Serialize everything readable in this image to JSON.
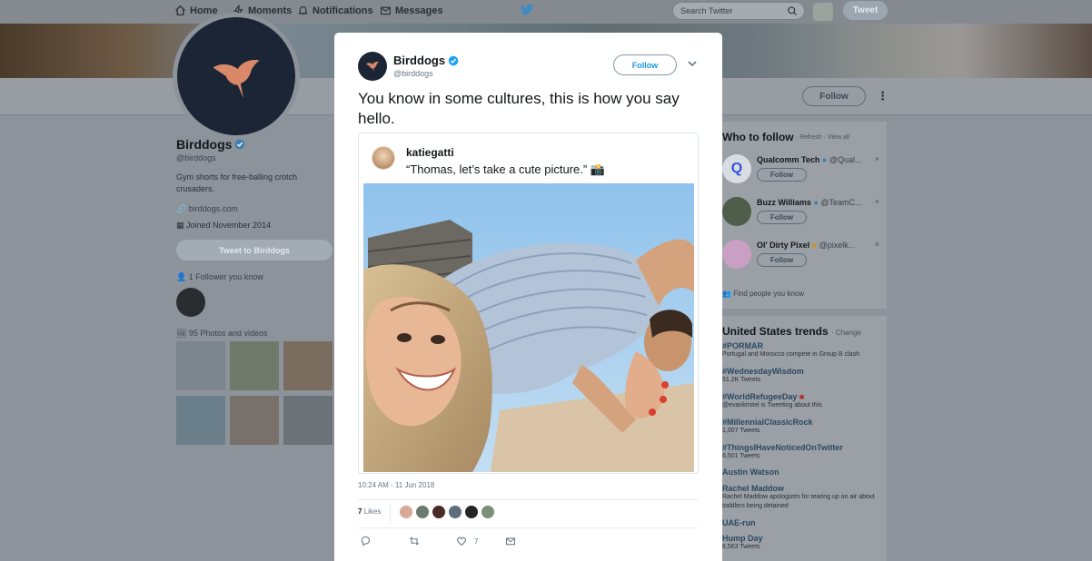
{
  "nav": {
    "home": "Home",
    "moments": "Moments",
    "notifications": "Notifications",
    "messages": "Messages",
    "search_placeholder": "Search Twitter",
    "tweet_button": "Tweet"
  },
  "profile": {
    "name": "Birddogs",
    "handle": "@birddogs",
    "bio": "Gym shorts for free-balling crotch crusaders.",
    "website": "birddogs.com",
    "joined": "Joined November 2014",
    "tweet_to": "Tweet to Birddogs",
    "followers_you_know": "1 Follower you know",
    "photos_videos": "95 Photos and videos",
    "follow_button": "Follow"
  },
  "who_to_follow": {
    "title": "Who to follow",
    "links": "· Refresh · View all",
    "follow_label": "Follow",
    "items": [
      {
        "name": "Qualcomm Tech",
        "handle": "@Qual...",
        "avatar_color": "#d9dce0"
      },
      {
        "name": "Buzz Williams",
        "handle": "@TeamC...",
        "avatar_color": "#4f5e4a"
      },
      {
        "name": "Ol' Dirty Pixel",
        "handle": "@pixelk...",
        "avatar_color": "#c9a0c4"
      }
    ],
    "find_people": "Find people you know"
  },
  "trends": {
    "title": "United States trends",
    "change": "· Change",
    "items": [
      {
        "name": "#PORMAR",
        "sub": "Portugal and Morocco compete in Group B clash"
      },
      {
        "name": "#WednesdayWisdom",
        "sub": "51.2K Tweets"
      },
      {
        "name": "#WorldRefugeeDay",
        "sub": "@evankirstel is Tweeting about this"
      },
      {
        "name": "#MillennialClassicRock",
        "sub": "1,007 Tweets"
      },
      {
        "name": "#ThingsIHaveNoticedOnTwitter",
        "sub": "6,501 Tweets"
      },
      {
        "name": "Austin Watson",
        "sub": ""
      },
      {
        "name": "Rachel Maddow",
        "sub": "Rachel Maddow apologizes for tearing up on air about toddlers being detained"
      },
      {
        "name": "UAE-run",
        "sub": ""
      },
      {
        "name": "Hump Day",
        "sub": "6,563 Tweets"
      }
    ]
  },
  "tweet": {
    "author": "Birddogs",
    "handle": "@birddogs",
    "follow": "Follow",
    "text": "You know in some cultures, this is how you say hello.",
    "quote_author": "katiegatti",
    "quote_text": "“Thomas, let’s take a cute picture.” 📸",
    "timestamp": "10:24 AM - 11 Jun 2018",
    "likes_count": "7",
    "likes_label": "Likes",
    "like_action_count": "7"
  },
  "colors": {
    "brand_blue": "#1da1f2",
    "verified": "#1da1f2",
    "avatar_navy": "#1c2535",
    "bird_orange": "#d9896a"
  }
}
